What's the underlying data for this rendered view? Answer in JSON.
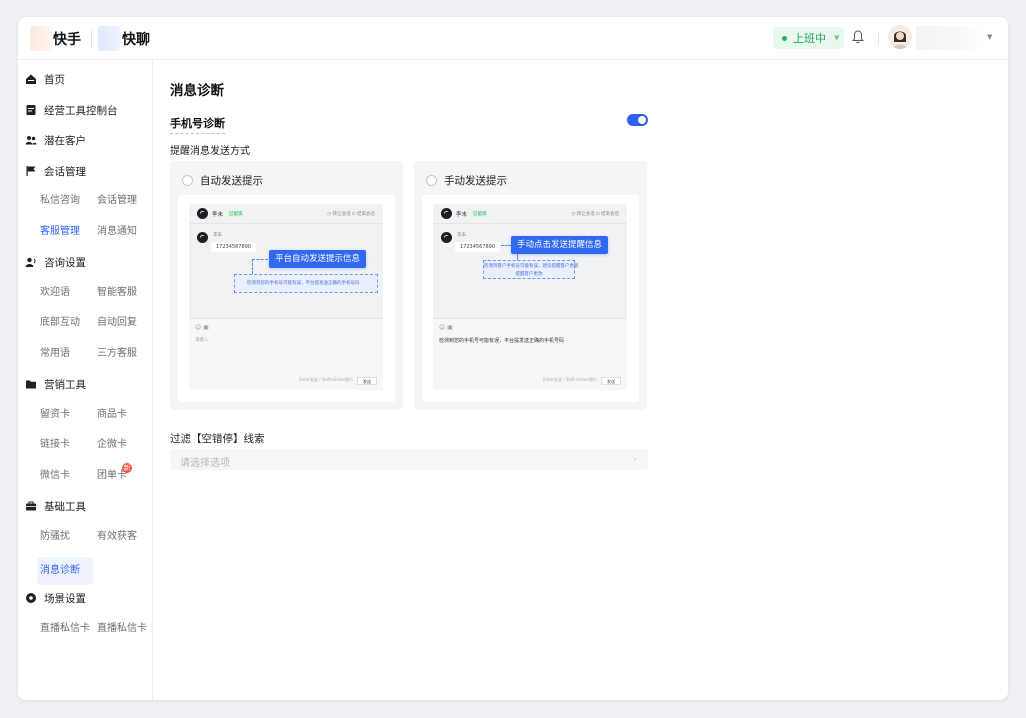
{
  "header": {
    "brand1": "快手",
    "brand2": "快聊",
    "status_label": "上班中",
    "brand_color": "#2f5ff0",
    "status_color": "#23a455"
  },
  "sidebar": {
    "groups": {
      "home": "首页",
      "console": "经营工具控制台",
      "leads": "潜在客户",
      "session": "会话管理",
      "consult": "咨询设置",
      "marketing": "营销工具",
      "basic": "基础工具",
      "scene": "场景设置"
    },
    "subs": {
      "private_consult": "私信咨询",
      "session_mgmt": "会话管理",
      "service_mgmt": "客服管理",
      "msg_notify": "消息通知",
      "welcome": "欢迎语",
      "smart_service": "智能客服",
      "bottom_interact": "底部互动",
      "auto_reply": "自动回复",
      "common_phrases": "常用语",
      "third_party": "三方客服",
      "lead_card": "留资卡",
      "product_card": "商品卡",
      "link_card": "链接卡",
      "wecom_card": "企微卡",
      "wechat_card": "微信卡",
      "group_card": "团单卡",
      "group_badge": "新",
      "anti_harass": "防骚扰",
      "effective_leads": "有效获客",
      "msg_diagnosis": "消息诊断",
      "live_card_1": "直播私信卡",
      "live_card_2": "直播私信卡"
    }
  },
  "main": {
    "page_title": "消息诊断",
    "section_title": "手机号诊断",
    "toggle_on": true,
    "method_label": "提醒消息发送方式",
    "cards": {
      "auto": {
        "radio_label": "自动发送提示",
        "mini_name": "李未",
        "mini_tag": "已留资",
        "mini_actions": "◷ 转让会话  ⏻ 结束会话",
        "phone": "17234567890",
        "callout": "平台自动发送提示信息",
        "hint": "检测到您的手机号可能有误，平台提发送正确的手机号码",
        "input_tools": "☺  ▣",
        "input_placeholder": "请输入",
        "send_hint": "Enter发送 / Shift+Enter换行",
        "send_label": "发送"
      },
      "manual": {
        "radio_label": "手动发送提示",
        "mini_name": "李未",
        "mini_tag": "已留资",
        "mini_actions": "◷ 转让会话  ⏻ 结束会话",
        "phone": "17234567890",
        "callout": "手动点击发送提醒信息",
        "hint_line1": "检测到客户手机号可能有误，建议提醒客户更新",
        "hint_line2": "提醒客户更改",
        "input_tools": "☺  ▣",
        "manual_hint": "检测到您的手机号可能有误，平台提发送正确的手机号码",
        "send_hint": "Enter发送 / Shift+Enter换行",
        "send_label": "发送"
      }
    },
    "filter_label": "过滤【空错停】线索",
    "filter_placeholder": "请选择选项"
  }
}
